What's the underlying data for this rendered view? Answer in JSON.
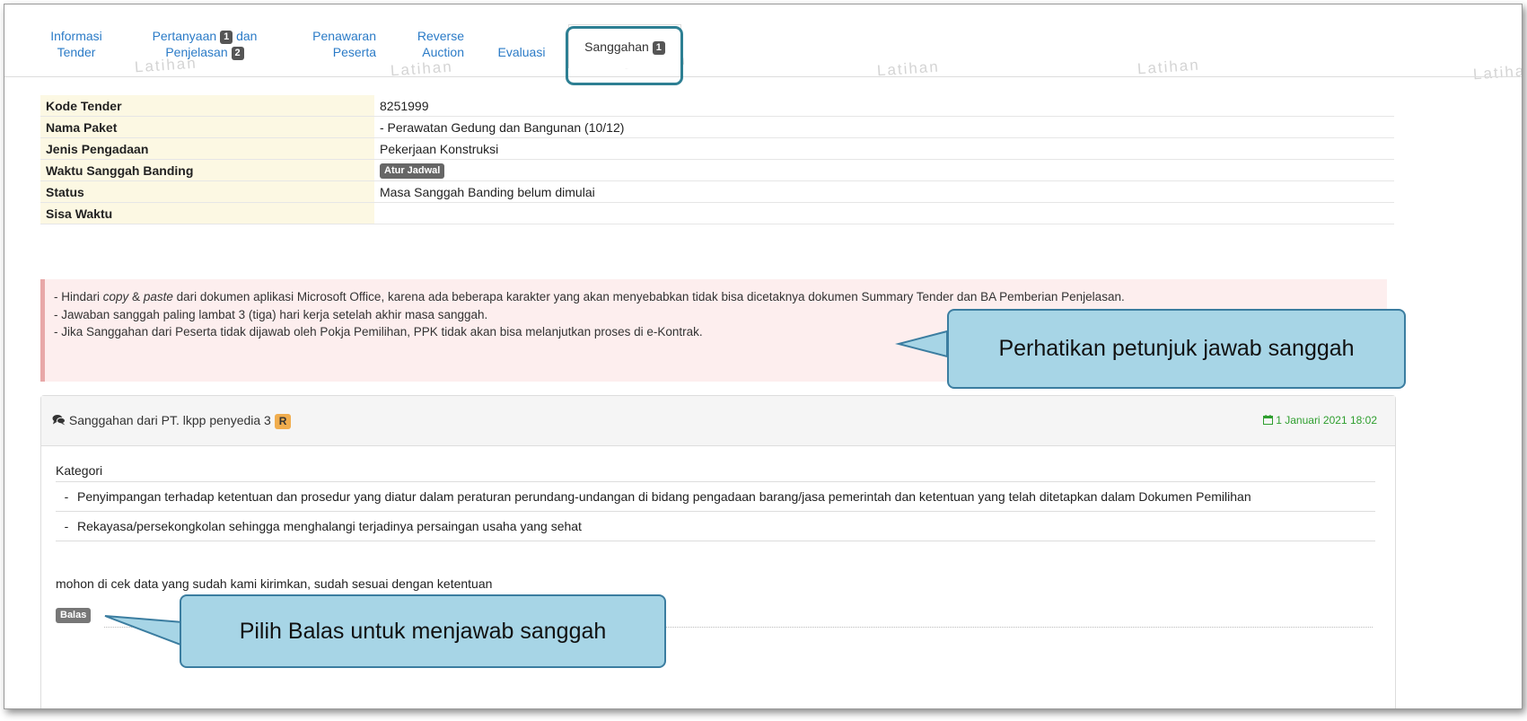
{
  "watermark": "Latihan",
  "tabs": [
    {
      "line1": "Informasi",
      "line2": "Tender"
    },
    {
      "line1": "Pertanyaan",
      "badge1": "1",
      "line1b": "dan",
      "line2": "Penjelasan",
      "badge2": "2"
    },
    {
      "line1": "Penawaran",
      "line2": "Peserta"
    },
    {
      "line1": "Reverse",
      "line2": "Auction"
    },
    {
      "label": "Evaluasi"
    },
    {
      "label": "Sanggahan",
      "badge": "1"
    }
  ],
  "info": {
    "kode_tender": {
      "label": "Kode Tender",
      "value": "8251999"
    },
    "nama_paket": {
      "label": "Nama Paket",
      "value": "- Perawatan Gedung dan Bangunan (10/12)"
    },
    "jenis": {
      "label": "Jenis Pengadaan",
      "value": "Pekerjaan Konstruksi"
    },
    "waktu": {
      "label": "Waktu Sanggah Banding",
      "button": "Atur Jadwal"
    },
    "status": {
      "label": "Status",
      "value": "Masa Sanggah Banding belum dimulai"
    },
    "sisa": {
      "label": "Sisa Waktu",
      "value": ""
    }
  },
  "alert": {
    "l1_pre": "- Hindari ",
    "l1_copy": "copy",
    "l1_amp": " & ",
    "l1_paste": "paste",
    "l1_post": " dari dokumen aplikasi Microsoft Office, karena ada beberapa karakter yang akan menyebabkan tidak bisa dicetaknya dokumen Summary Tender dan BA Pemberian Penjelasan.",
    "l2": "- Jawaban sanggah paling lambat 3 (tiga) hari kerja setelah akhir masa sanggah.",
    "l3": "- Jika Sanggahan dari Peserta tidak dijawab oleh Pokja Pemilihan, PPK tidak akan bisa melanjutkan proses di e-Kontrak."
  },
  "sanggahan": {
    "title": "Sanggahan dari PT. lkpp penyedia 3",
    "badge": "R",
    "date": "1 Januari 2021 18:02",
    "kategori_label": "Kategori",
    "kategori": [
      "Penyimpangan terhadap ketentuan dan prosedur yang diatur dalam peraturan perundang-undangan di bidang pengadaan barang/jasa pemerintah dan ketentuan yang telah ditetapkan dalam Dokumen Pemilihan",
      "Rekayasa/persekongkolan sehingga menghalangi terjadinya persaingan usaha yang sehat"
    ],
    "message": "mohon di cek data yang sudah kami kirimkan, sudah sesuai dengan ketentuan",
    "reply_button": "Balas"
  },
  "callouts": {
    "petunjuk": "Perhatikan petunjuk jawab sanggah",
    "balas": "Pilih Balas untuk menjawab sanggah"
  },
  "colors": {
    "link": "#2b7bc7",
    "callout_fill": "#a7d5e6",
    "callout_border": "#3b7da0",
    "alert_bg": "#fdeeee",
    "label_bg": "#fcf8e3",
    "date_green": "#2e9e2e",
    "badge_r": "#f0ad4e"
  }
}
